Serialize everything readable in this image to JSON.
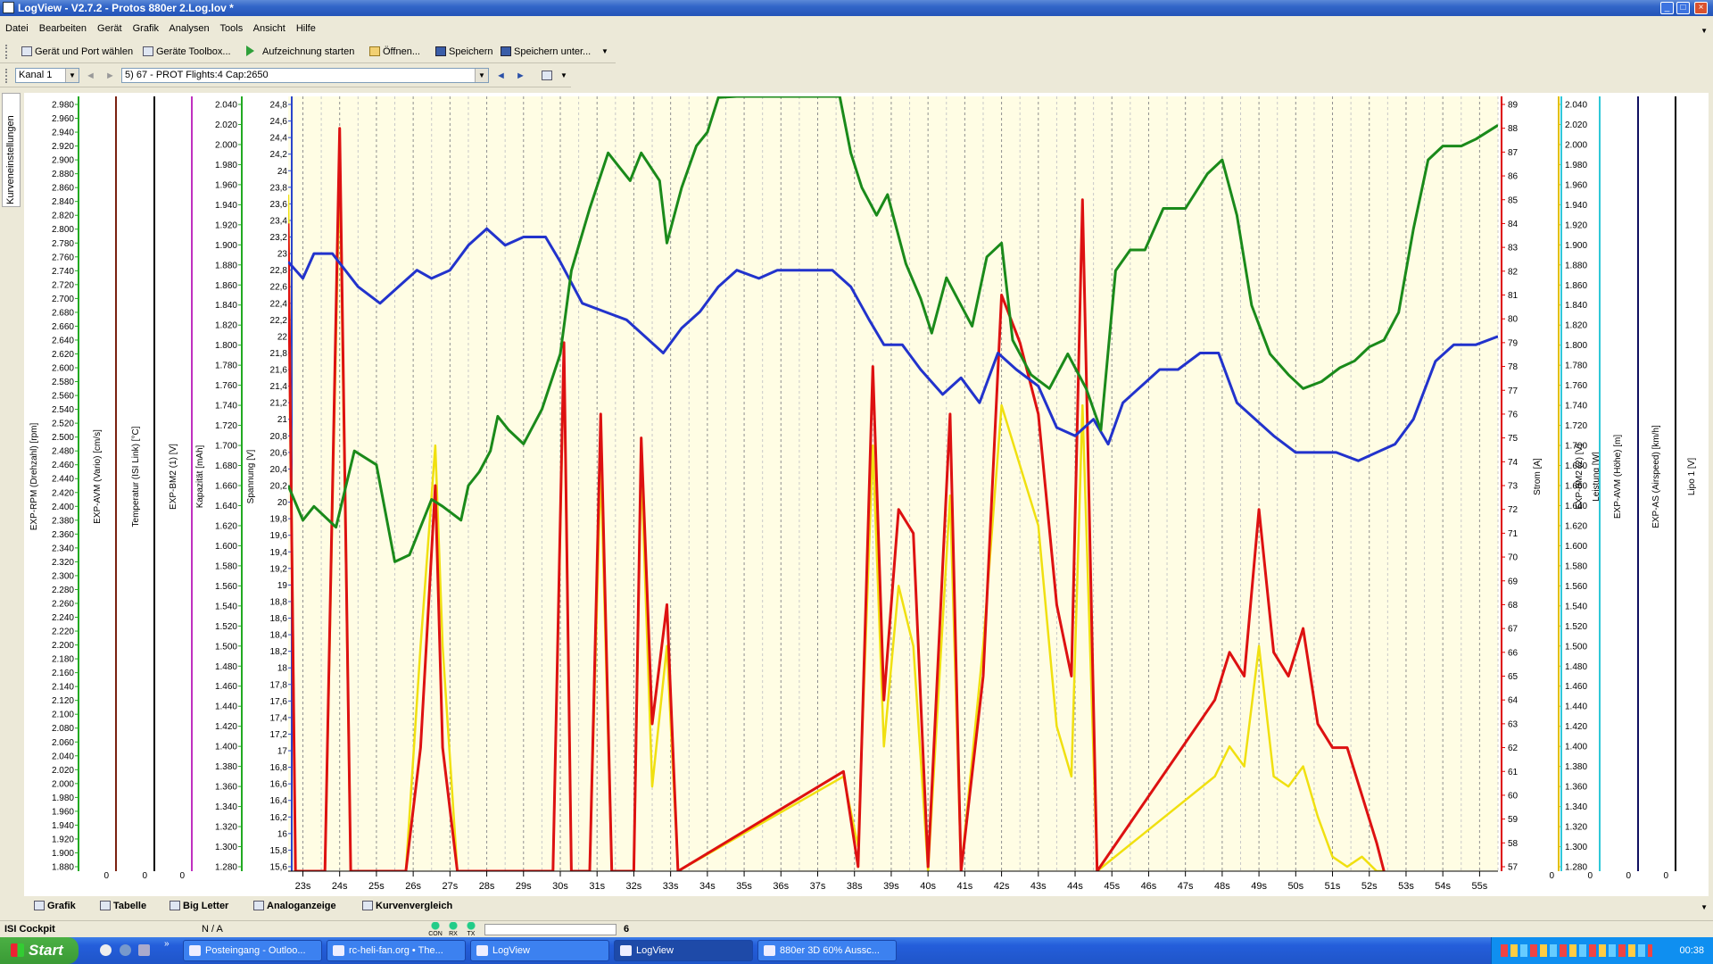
{
  "window": {
    "title": "LogView - V2.7.2 - Protos 880er 2.Log.lov *"
  },
  "menu": [
    "Datei",
    "Bearbeiten",
    "Gerät",
    "Grafik",
    "Analysen",
    "Tools",
    "Ansicht",
    "Hilfe"
  ],
  "toolbar1": {
    "device_port": "Gerät und Port wählen",
    "toolbox": "Geräte Toolbox...",
    "record": "Aufzeichnung starten",
    "open": "Öffnen...",
    "save": "Speichern",
    "save_as": "Speichern unter..."
  },
  "toolbar2": {
    "channel": "Kanal 1",
    "flight": "5) 67 - PROT  Flights:4  Cap:2650"
  },
  "side_tab": "Kurveneinstellungen",
  "chart_data": {
    "type": "line",
    "x_ticks": [
      "23s",
      "24s",
      "25s",
      "26s",
      "27s",
      "28s",
      "29s",
      "30s",
      "31s",
      "32s",
      "33s",
      "34s",
      "35s",
      "36s",
      "37s",
      "38s",
      "39s",
      "40s",
      "41s",
      "42s",
      "43s",
      "44s",
      "45s",
      "46s",
      "47s",
      "48s",
      "49s",
      "50s",
      "51s",
      "52s",
      "53s",
      "54s",
      "55s"
    ],
    "xlim": [
      22.6,
      55.5
    ],
    "left_axes": [
      {
        "label": "EXP-RPM (Drehzahl) [rpm]",
        "ticks_from": 1880,
        "ticks_to": 2980,
        "step": 20,
        "color": "#22aa22"
      },
      {
        "label": "EXP-AVM (Vario) [cm/s]",
        "zero": "0",
        "color": "#7a2010"
      },
      {
        "label": "Temperatur (ISI Link) [°C]",
        "zero": "0",
        "color": "#000000"
      },
      {
        "label": "EXP-BM2 (1) [V]",
        "zero": "0",
        "color": "#c030c0"
      },
      {
        "label": "Kapazität [mAh]",
        "ticks_from": 1280,
        "ticks_to": 2040,
        "step": 20,
        "color": "#22aa22"
      },
      {
        "label": "Spannung [V]",
        "ticks_from": 15.6,
        "ticks_to": 24.8,
        "step": 0.2,
        "color": "#2a44cc"
      }
    ],
    "right_axes": [
      {
        "label": "Strom [A]",
        "ticks_from": 57,
        "ticks_to": 89,
        "step": 1,
        "color": "#dd0000"
      },
      {
        "label": "Leistung [W]",
        "ticks_from": 1280,
        "ticks_to": 2040,
        "step": 20,
        "color": "#e0c000"
      },
      {
        "label": "EXP-BM2 (2) [V]",
        "zero": "0",
        "color": "#30c8d8"
      },
      {
        "label": "EXP-AVM (Höhe) [m]",
        "zero": "0",
        "color": "#30c8d8"
      },
      {
        "label": "EXP-AS (Airspeed) [km/h]",
        "zero": "0",
        "color": "#101060"
      },
      {
        "label": "Lipo 1 [V]",
        "zero": "0",
        "color": "#000000"
      }
    ],
    "series": [
      {
        "axis": "RPM",
        "color": "#1a8a1a",
        "points": [
          [
            22.6,
            2430
          ],
          [
            23.0,
            2380
          ],
          [
            23.3,
            2400
          ],
          [
            23.9,
            2370
          ],
          [
            24.4,
            2480
          ],
          [
            25.0,
            2460
          ],
          [
            25.5,
            2320
          ],
          [
            25.9,
            2330
          ],
          [
            26.5,
            2410
          ],
          [
            26.8,
            2400
          ],
          [
            27.3,
            2380
          ],
          [
            27.5,
            2430
          ],
          [
            27.8,
            2450
          ],
          [
            28.1,
            2480
          ],
          [
            28.3,
            2530
          ],
          [
            28.6,
            2510
          ],
          [
            29.0,
            2490
          ],
          [
            29.5,
            2540
          ],
          [
            30.0,
            2620
          ],
          [
            30.3,
            2740
          ],
          [
            30.8,
            2830
          ],
          [
            31.3,
            2910
          ],
          [
            31.6,
            2890
          ],
          [
            31.9,
            2870
          ],
          [
            32.2,
            2910
          ],
          [
            32.7,
            2870
          ],
          [
            32.9,
            2780
          ],
          [
            33.3,
            2860
          ],
          [
            33.7,
            2920
          ],
          [
            34.0,
            2940
          ],
          [
            34.3,
            2990
          ],
          [
            34.8,
            3010
          ],
          [
            35.3,
            3030
          ],
          [
            35.7,
            3020
          ],
          [
            36.2,
            3020
          ],
          [
            36.7,
            3010
          ],
          [
            37.2,
            3020
          ],
          [
            37.6,
            3010
          ],
          [
            37.9,
            2910
          ],
          [
            38.2,
            2860
          ],
          [
            38.6,
            2820
          ],
          [
            38.9,
            2850
          ],
          [
            39.4,
            2750
          ],
          [
            39.8,
            2700
          ],
          [
            40.1,
            2650
          ],
          [
            40.5,
            2730
          ],
          [
            40.9,
            2690
          ],
          [
            41.2,
            2660
          ],
          [
            41.6,
            2760
          ],
          [
            42.0,
            2780
          ],
          [
            42.3,
            2640
          ],
          [
            42.8,
            2590
          ],
          [
            43.3,
            2570
          ],
          [
            43.8,
            2620
          ],
          [
            44.3,
            2570
          ],
          [
            44.7,
            2510
          ],
          [
            45.1,
            2740
          ],
          [
            45.5,
            2770
          ],
          [
            45.9,
            2770
          ],
          [
            46.4,
            2830
          ],
          [
            47.0,
            2830
          ],
          [
            47.6,
            2880
          ],
          [
            48.0,
            2900
          ],
          [
            48.4,
            2820
          ],
          [
            48.8,
            2690
          ],
          [
            49.3,
            2620
          ],
          [
            49.8,
            2590
          ],
          [
            50.2,
            2570
          ],
          [
            50.7,
            2580
          ],
          [
            51.2,
            2600
          ],
          [
            51.6,
            2610
          ],
          [
            52.0,
            2630
          ],
          [
            52.4,
            2640
          ],
          [
            52.8,
            2680
          ],
          [
            53.2,
            2800
          ],
          [
            53.6,
            2900
          ],
          [
            54.0,
            2920
          ],
          [
            54.5,
            2920
          ],
          [
            54.9,
            2930
          ],
          [
            55.5,
            2950
          ]
        ]
      },
      {
        "axis": "Spannung",
        "color": "#2233cc",
        "points": [
          [
            22.6,
            22.9
          ],
          [
            23.0,
            22.7
          ],
          [
            23.3,
            23.0
          ],
          [
            23.8,
            23.0
          ],
          [
            24.5,
            22.6
          ],
          [
            25.1,
            22.4
          ],
          [
            25.6,
            22.6
          ],
          [
            26.1,
            22.8
          ],
          [
            26.5,
            22.7
          ],
          [
            27.0,
            22.8
          ],
          [
            27.5,
            23.1
          ],
          [
            28.0,
            23.3
          ],
          [
            28.5,
            23.1
          ],
          [
            29.0,
            23.2
          ],
          [
            29.6,
            23.2
          ],
          [
            30.0,
            22.9
          ],
          [
            30.6,
            22.4
          ],
          [
            31.2,
            22.3
          ],
          [
            31.8,
            22.2
          ],
          [
            32.3,
            22.0
          ],
          [
            32.8,
            21.8
          ],
          [
            33.3,
            22.1
          ],
          [
            33.8,
            22.3
          ],
          [
            34.3,
            22.6
          ],
          [
            34.8,
            22.8
          ],
          [
            35.4,
            22.7
          ],
          [
            35.9,
            22.8
          ],
          [
            36.4,
            22.8
          ],
          [
            36.9,
            22.8
          ],
          [
            37.4,
            22.8
          ],
          [
            37.9,
            22.6
          ],
          [
            38.4,
            22.2
          ],
          [
            38.8,
            21.9
          ],
          [
            39.3,
            21.9
          ],
          [
            39.8,
            21.6
          ],
          [
            40.4,
            21.3
          ],
          [
            40.9,
            21.5
          ],
          [
            41.4,
            21.2
          ],
          [
            41.9,
            21.8
          ],
          [
            42.4,
            21.6
          ],
          [
            43.0,
            21.4
          ],
          [
            43.5,
            20.9
          ],
          [
            44.0,
            20.8
          ],
          [
            44.5,
            21.0
          ],
          [
            44.9,
            20.7
          ],
          [
            45.3,
            21.2
          ],
          [
            45.8,
            21.4
          ],
          [
            46.3,
            21.6
          ],
          [
            46.8,
            21.6
          ],
          [
            47.4,
            21.8
          ],
          [
            47.9,
            21.8
          ],
          [
            48.4,
            21.2
          ],
          [
            48.9,
            21.0
          ],
          [
            49.4,
            20.8
          ],
          [
            50.0,
            20.6
          ],
          [
            50.6,
            20.6
          ],
          [
            51.1,
            20.6
          ],
          [
            51.7,
            20.5
          ],
          [
            52.2,
            20.6
          ],
          [
            52.7,
            20.7
          ],
          [
            53.2,
            21.0
          ],
          [
            53.8,
            21.7
          ],
          [
            54.3,
            21.9
          ],
          [
            54.9,
            21.9
          ],
          [
            55.5,
            22.0
          ]
        ]
      },
      {
        "axis": "Strom",
        "color": "#dd1111",
        "points": [
          [
            22.6,
            84
          ],
          [
            22.8,
            53
          ],
          [
            23.6,
            55
          ],
          [
            24.0,
            88
          ],
          [
            24.3,
            55
          ],
          [
            24.8,
            53
          ],
          [
            25.3,
            55
          ],
          [
            25.8,
            55
          ],
          [
            26.2,
            62
          ],
          [
            26.6,
            73
          ],
          [
            26.8,
            62
          ],
          [
            27.2,
            55
          ],
          [
            29.8,
            53
          ],
          [
            30.1,
            79
          ],
          [
            30.3,
            55
          ],
          [
            30.8,
            53
          ],
          [
            31.1,
            76
          ],
          [
            31.4,
            55
          ],
          [
            32.0,
            53
          ],
          [
            32.2,
            75
          ],
          [
            32.5,
            63
          ],
          [
            32.9,
            68
          ],
          [
            33.2,
            55
          ],
          [
            37.7,
            61
          ],
          [
            38.1,
            57
          ],
          [
            38.5,
            78
          ],
          [
            38.8,
            64
          ],
          [
            39.2,
            72
          ],
          [
            39.6,
            71
          ],
          [
            40.0,
            57
          ],
          [
            40.6,
            76
          ],
          [
            40.9,
            55
          ],
          [
            41.5,
            65
          ],
          [
            42.0,
            81
          ],
          [
            42.5,
            79
          ],
          [
            43.0,
            76
          ],
          [
            43.5,
            68
          ],
          [
            43.9,
            65
          ],
          [
            44.2,
            85
          ],
          [
            44.6,
            55
          ],
          [
            47.8,
            64
          ],
          [
            48.2,
            66
          ],
          [
            48.6,
            65
          ],
          [
            49.0,
            72
          ],
          [
            49.4,
            66
          ],
          [
            49.8,
            65
          ],
          [
            50.2,
            67
          ],
          [
            50.6,
            63
          ],
          [
            51.0,
            62
          ],
          [
            51.4,
            62
          ],
          [
            51.8,
            60
          ],
          [
            52.2,
            58
          ],
          [
            52.4,
            55
          ]
        ]
      },
      {
        "axis": "Leistung",
        "color": "#f0e010",
        "points": [
          [
            22.6,
            1950
          ],
          [
            22.8,
            1250
          ],
          [
            23.6,
            1250
          ],
          [
            24.0,
            1980
          ],
          [
            24.3,
            1250
          ],
          [
            25.3,
            1250
          ],
          [
            25.8,
            1250
          ],
          [
            26.2,
            1500
          ],
          [
            26.6,
            1700
          ],
          [
            26.8,
            1500
          ],
          [
            27.2,
            1250
          ],
          [
            29.8,
            1250
          ],
          [
            30.1,
            1790
          ],
          [
            30.3,
            1250
          ],
          [
            30.8,
            1250
          ],
          [
            31.1,
            1680
          ],
          [
            31.4,
            1250
          ],
          [
            32.0,
            1250
          ],
          [
            32.2,
            1680
          ],
          [
            32.5,
            1360
          ],
          [
            32.9,
            1500
          ],
          [
            33.2,
            1250
          ],
          [
            37.7,
            1370
          ],
          [
            38.1,
            1300
          ],
          [
            38.5,
            1700
          ],
          [
            38.8,
            1400
          ],
          [
            39.2,
            1560
          ],
          [
            39.6,
            1500
          ],
          [
            40.0,
            1250
          ],
          [
            40.6,
            1650
          ],
          [
            40.9,
            1250
          ],
          [
            41.5,
            1500
          ],
          [
            42.0,
            1740
          ],
          [
            42.5,
            1680
          ],
          [
            43.0,
            1620
          ],
          [
            43.5,
            1420
          ],
          [
            43.9,
            1370
          ],
          [
            44.2,
            1740
          ],
          [
            44.6,
            1250
          ],
          [
            47.8,
            1370
          ],
          [
            48.2,
            1400
          ],
          [
            48.6,
            1380
          ],
          [
            49.0,
            1500
          ],
          [
            49.4,
            1370
          ],
          [
            49.8,
            1360
          ],
          [
            50.2,
            1380
          ],
          [
            50.6,
            1330
          ],
          [
            51.0,
            1290
          ],
          [
            51.4,
            1280
          ],
          [
            51.8,
            1290
          ],
          [
            52.2,
            1270
          ],
          [
            52.4,
            1250
          ]
        ]
      }
    ]
  },
  "bottom_tabs": [
    "Grafik",
    "Tabelle",
    "Big Letter",
    "Analoganzeige",
    "Kurvenvergleich"
  ],
  "status": {
    "left": "ISI Cockpit",
    "middle": "N / A",
    "lamps": [
      "CON",
      "RX",
      "TX"
    ],
    "count": "6"
  },
  "taskbar": {
    "start": "Start",
    "items": [
      "Posteingang - Outloo...",
      "rc-heli-fan.org • The...",
      "LogView",
      "LogView",
      "880er 3D 60% Aussc..."
    ],
    "clock": "00:38"
  }
}
